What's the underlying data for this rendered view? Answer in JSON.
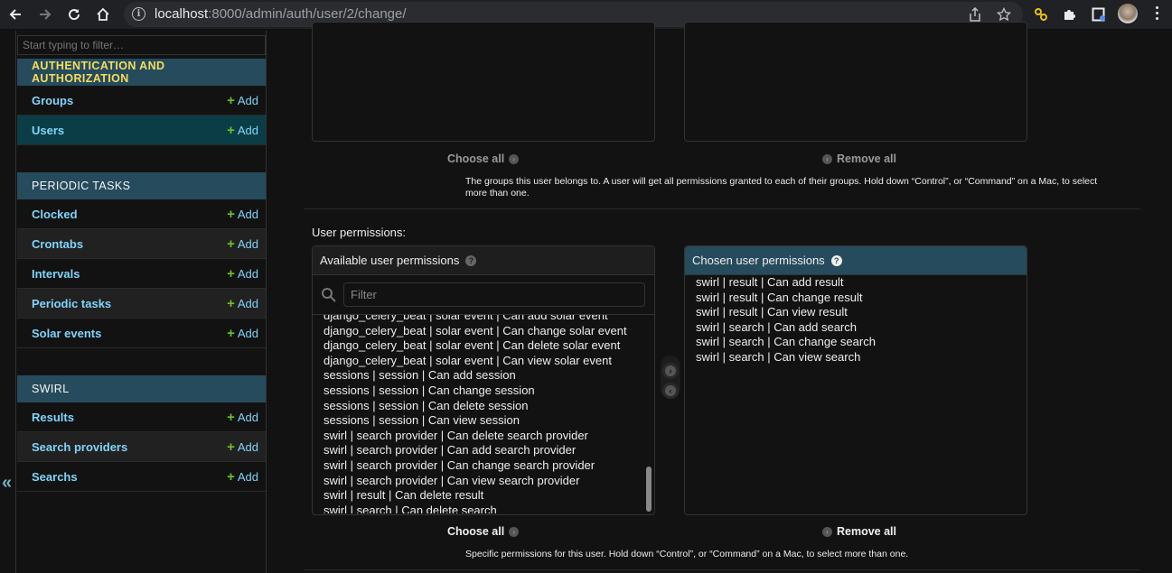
{
  "browser": {
    "url_host": "localhost",
    "url_rest": ":8000/admin/auth/user/2/change/",
    "icons": {
      "back": "arrow-left-icon",
      "forward": "arrow-right-icon",
      "reload": "reload-icon",
      "home": "home-icon",
      "info": "info-icon",
      "share": "share-icon",
      "bookmark": "star-icon",
      "extension_1": "link-extension-icon",
      "extensions": "puzzle-icon",
      "tab_search": "sidebar-icon",
      "profile": "avatar",
      "menu": "kebab-menu-icon"
    }
  },
  "sidebar": {
    "filter_placeholder": "Start typing to filter…",
    "collapse_glyph": "«",
    "add_label": "Add",
    "plus_glyph": "+",
    "modules": [
      {
        "caption": "AUTHENTICATION AND AUTHORIZATION",
        "items": [
          {
            "label": "Groups"
          },
          {
            "label": "Users",
            "current": true
          }
        ]
      },
      {
        "caption": "PERIODIC TASKS",
        "items": [
          {
            "label": "Clocked"
          },
          {
            "label": "Crontabs"
          },
          {
            "label": "Intervals"
          },
          {
            "label": "Periodic tasks"
          },
          {
            "label": "Solar events"
          }
        ]
      },
      {
        "caption": "SWIRL",
        "items": [
          {
            "label": "Results"
          },
          {
            "label": "Search providers"
          },
          {
            "label": "Searchs"
          }
        ]
      }
    ]
  },
  "groups_widget": {
    "choose_all": "Choose all",
    "remove_all": "Remove all",
    "help_text_line1": "The groups this user belongs to. A user will get all permissions granted to each of their groups. Hold down “Control”, or “Command” on a Mac, to select",
    "help_text_line2": "more than one."
  },
  "permissions_widget": {
    "label": "User permissions:",
    "available_title": "Available user permissions",
    "chosen_title": "Chosen user permissions",
    "help_glyph": "?",
    "filter_placeholder": "Filter",
    "available": [
      "django_celery_beat | solar event | Can add solar event",
      "django_celery_beat | solar event | Can change solar event",
      "django_celery_beat | solar event | Can delete solar event",
      "django_celery_beat | solar event | Can view solar event",
      "sessions | session | Can add session",
      "sessions | session | Can change session",
      "sessions | session | Can delete session",
      "sessions | session | Can view session",
      "swirl | search provider | Can delete search provider",
      "swirl | search provider | Can add search provider",
      "swirl | search provider | Can change search provider",
      "swirl | search provider | Can view search provider",
      "swirl | result | Can delete result",
      "swirl | search | Can delete search"
    ],
    "chosen": [
      "swirl | result | Can add result",
      "swirl | result | Can change result",
      "swirl | result | Can view result",
      "swirl | search | Can add search",
      "swirl | search | Can change search",
      "swirl | search | Can view search"
    ],
    "choose_all": "Choose all",
    "remove_all": "Remove all",
    "help_text": "Specific permissions for this user. Hold down “Control”, or “Command” on a Mac, to select more than one."
  }
}
